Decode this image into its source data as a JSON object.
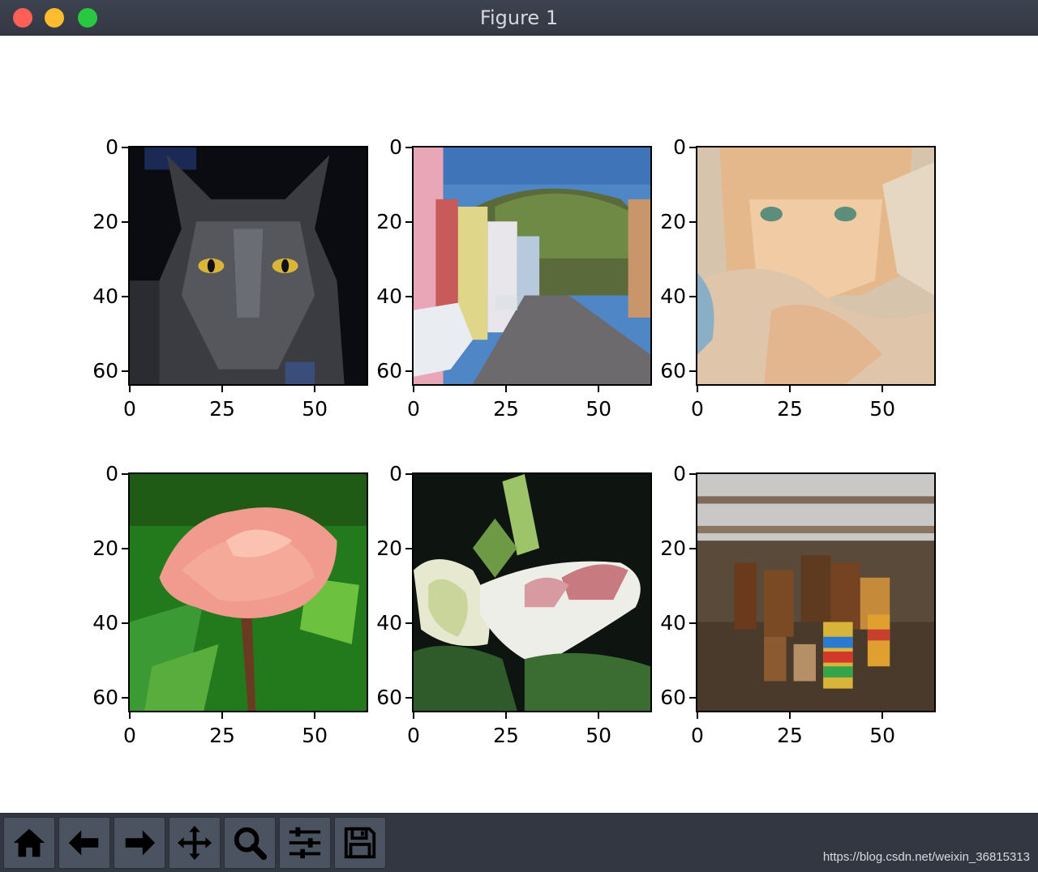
{
  "window": {
    "title": "Figure 1"
  },
  "figure": {
    "subplots": [
      {
        "name": "black-cat",
        "yticks": [
          "0",
          "20",
          "40",
          "60"
        ],
        "xticks": [
          "0",
          "25",
          "50"
        ]
      },
      {
        "name": "street",
        "yticks": [
          "0",
          "20",
          "40",
          "60"
        ],
        "xticks": [
          "0",
          "25",
          "50"
        ]
      },
      {
        "name": "orange-cat",
        "yticks": [
          "0",
          "20",
          "40",
          "60"
        ],
        "xticks": [
          "0",
          "25",
          "50"
        ]
      },
      {
        "name": "pink-rose",
        "yticks": [
          "0",
          "20",
          "40",
          "60"
        ],
        "xticks": [
          "0",
          "25",
          "50"
        ]
      },
      {
        "name": "white-lily",
        "yticks": [
          "0",
          "20",
          "40",
          "60"
        ],
        "xticks": [
          "0",
          "25",
          "50"
        ]
      },
      {
        "name": "drums",
        "yticks": [
          "0",
          "20",
          "40",
          "60"
        ],
        "xticks": [
          "0",
          "25",
          "50"
        ]
      }
    ]
  },
  "toolbar": {
    "buttons": [
      {
        "icon": "home-icon",
        "label": "Home"
      },
      {
        "icon": "back-arrow-icon",
        "label": "Back"
      },
      {
        "icon": "forward-arrow-icon",
        "label": "Forward"
      },
      {
        "icon": "pan-icon",
        "label": "Pan"
      },
      {
        "icon": "zoom-icon",
        "label": "Zoom"
      },
      {
        "icon": "subplots-config-icon",
        "label": "Configure subplots"
      },
      {
        "icon": "save-icon",
        "label": "Save"
      }
    ],
    "watermark": "https://blog.csdn.net/weixin_36815313"
  }
}
